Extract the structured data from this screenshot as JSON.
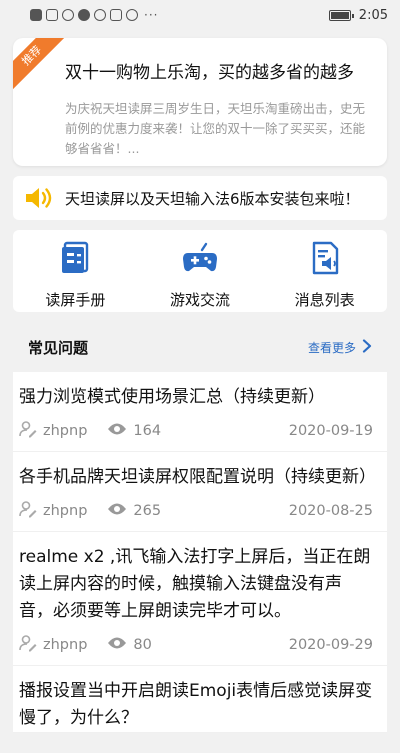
{
  "status_bar": {
    "time": "2:05",
    "more": "···"
  },
  "promo": {
    "badge": "推荐",
    "title": "双十一购物上乐淘，买的越多省的越多",
    "desc": "为庆祝天坦读屏三周岁生日，天坦乐淘重磅出击，史无前例的优惠力度来袭！让您的双十一除了买买买，还能够省省省！..."
  },
  "notice": {
    "text": "天坦读屏以及天坦输入法6版本安装包来啦！"
  },
  "shortcuts": [
    {
      "label": "读屏手册",
      "icon": "manual-icon"
    },
    {
      "label": "游戏交流",
      "icon": "gamepad-icon"
    },
    {
      "label": "消息列表",
      "icon": "message-list-icon"
    }
  ],
  "faq": {
    "title": "常见问题",
    "more_label": "查看更多",
    "items": [
      {
        "question": "强力浏览模式使用场景汇总（持续更新）",
        "user": "zhpnp",
        "views": "164",
        "date": "2020-09-19"
      },
      {
        "question": "各手机品牌天坦读屏权限配置说明（持续更新）",
        "user": "zhpnp",
        "views": "265",
        "date": "2020-08-25"
      },
      {
        "question": " realme x2 ,讯飞输入法打字上屏后，当正在朗读上屏内容的时候，触摸输入法键盘没有声音，必须要等上屏朗读完毕才可以。",
        "user": "zhpnp",
        "views": "80",
        "date": "2020-09-29"
      },
      {
        "question": "播报设置当中开启朗读Emoji表情后感觉读屏变慢了，为什么？",
        "user": "",
        "views": "",
        "date": ""
      }
    ]
  },
  "colors": {
    "accent_blue": "#2b6cc4",
    "ribbon_orange": "#f07b2c",
    "speaker_yellow": "#f5b800"
  }
}
